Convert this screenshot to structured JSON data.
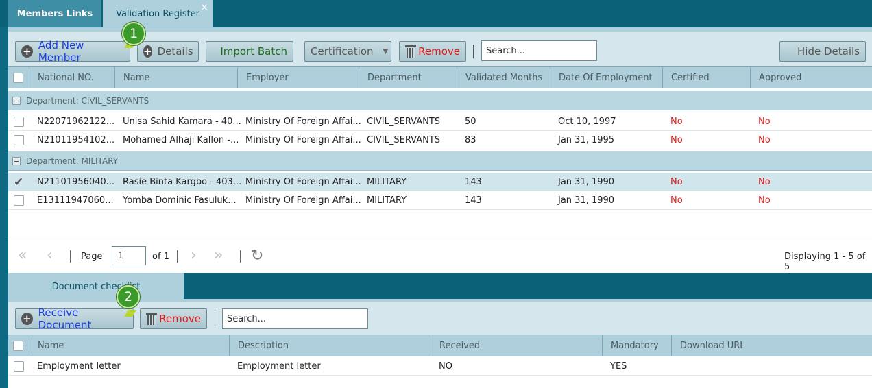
{
  "tabs": {
    "members_links": "Members Links",
    "validation_register": "Validation Register",
    "close_glyph": "×"
  },
  "toolbar": {
    "add_new_member": "Add New Member",
    "details": "Details",
    "import_batch": "Import Batch",
    "certification": "Certification",
    "remove": "Remove",
    "search_placeholder": "Search...",
    "hide_details": "Hide Details"
  },
  "badges": {
    "one": "1",
    "two": "2"
  },
  "members_grid": {
    "columns": [
      "National NO.",
      "Name",
      "Employer",
      "Department",
      "Validated Months",
      "Date Of Employment",
      "Certified",
      "Approved"
    ],
    "groups": [
      {
        "label": "Department: CIVIL_SERVANTS",
        "rows": [
          {
            "national_no": "N22071962122...",
            "name": "Unisa Sahid Kamara - 40...",
            "employer": "Ministry Of Foreign Affai...",
            "department": "CIVIL_SERVANTS",
            "validated_months": "50",
            "date_of_employment": "Oct 10, 1997",
            "certified": "No",
            "approved": "No",
            "checked": false
          },
          {
            "national_no": "N21011954102...",
            "name": "Mohamed Alhaji Kallon -...",
            "employer": "Ministry Of Foreign Affai...",
            "department": "CIVIL_SERVANTS",
            "validated_months": "83",
            "date_of_employment": "Jan 31, 1995",
            "certified": "No",
            "approved": "No",
            "checked": false
          }
        ]
      },
      {
        "label": "Department: MILITARY",
        "rows": [
          {
            "national_no": "N21101956040...",
            "name": "Rasie Binta Kargbo - 403...",
            "employer": "Ministry Of Foreign Affai...",
            "department": "MILITARY",
            "validated_months": "143",
            "date_of_employment": "Jan 31, 1990",
            "certified": "No",
            "approved": "No",
            "checked": true
          },
          {
            "national_no": "E13111947060...",
            "name": "Yomba Dominic Fasuluk...",
            "employer": "Ministry Of Foreign Affai...",
            "department": "MILITARY",
            "validated_months": "143",
            "date_of_employment": "Jan 31, 1990",
            "certified": "No",
            "approved": "No",
            "checked": false
          }
        ]
      }
    ]
  },
  "pager": {
    "page_label": "Page",
    "page_value": "1",
    "of_label": "of 1",
    "displaying": "Displaying 1 - 5 of 5"
  },
  "document_panel": {
    "tab_label": "Document checklist",
    "receive_document": "Receive Document",
    "remove": "Remove",
    "search_placeholder": "Search...",
    "columns": [
      "Name",
      "Description",
      "Received",
      "Mandatory",
      "Download URL"
    ],
    "rows": [
      {
        "name": "Employment letter",
        "description": "Employment letter",
        "received": "NO",
        "mandatory": "YES",
        "download_url": ""
      }
    ]
  },
  "colors": {
    "header_dark": "#0b6278",
    "tab_light": "#aed0dc",
    "link_blue": "#1a3de0",
    "no_red": "#e01a1a",
    "badge_green": "#3a9a2a"
  }
}
